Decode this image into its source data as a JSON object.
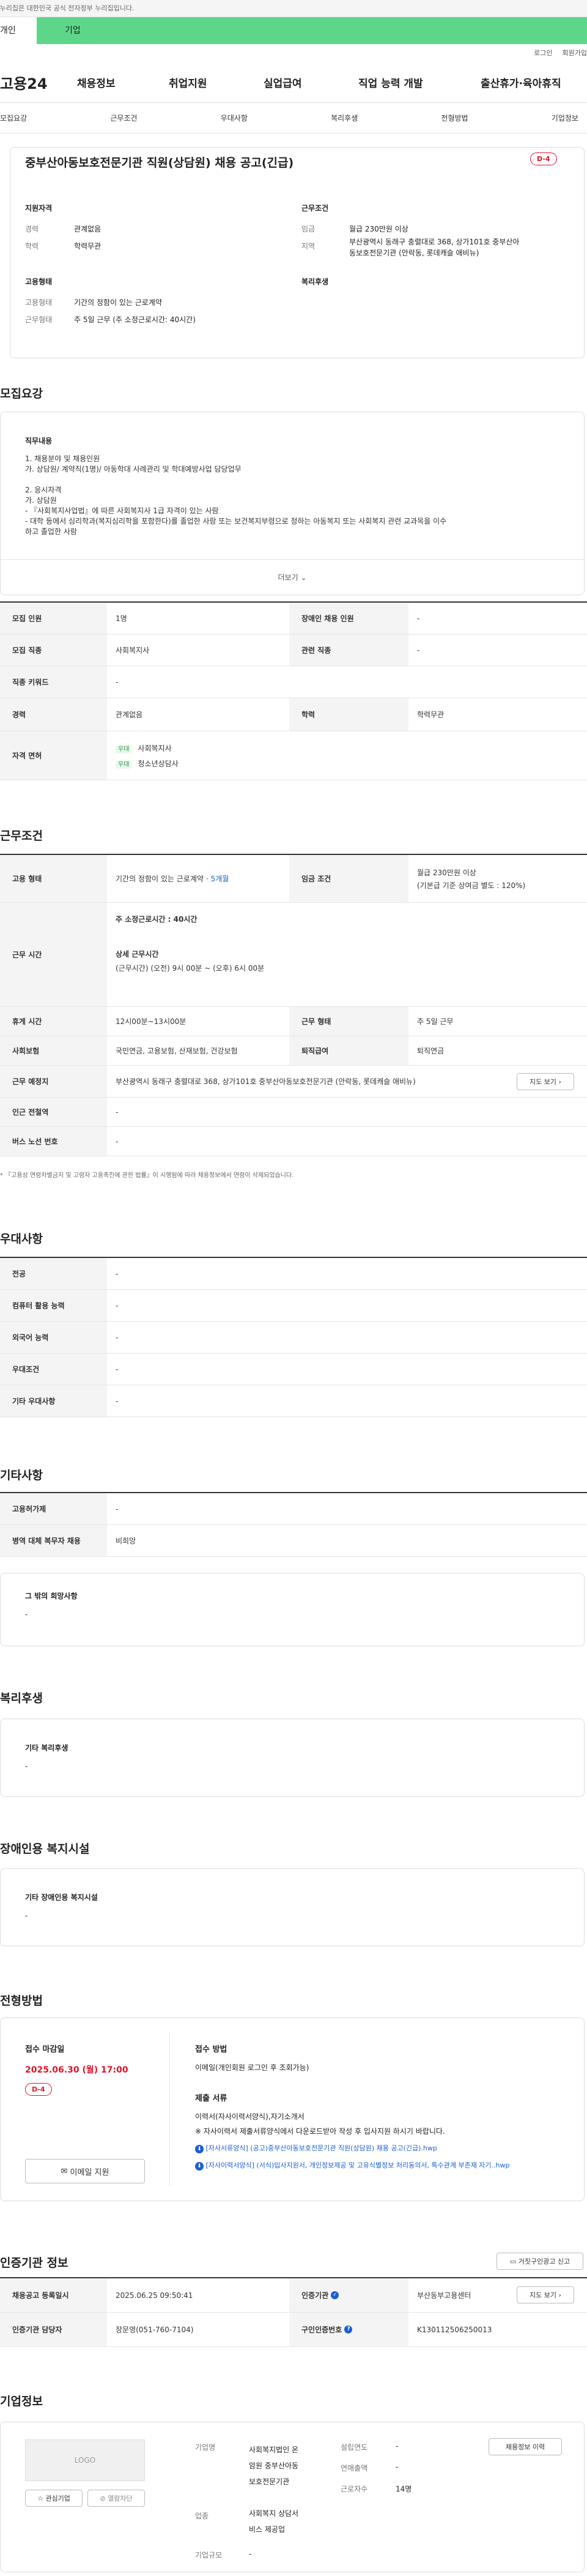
{
  "banner": {
    "notice": "이 누리집은 대한민국 공식 전자정부 누리집입니다."
  },
  "tabs": {
    "personal": "개인",
    "company": "기업"
  },
  "util": {
    "login": "로그인",
    "join": "회원가입"
  },
  "gnb": {
    "logo": "고용24",
    "menu": [
      "채용정보",
      "취업지원",
      "실업급여",
      "직업 능력 개발",
      "출산휴가·육아휴직"
    ]
  },
  "snb": [
    "모집요강",
    "근무조건",
    "우대사항",
    "복리후생",
    "전형방법",
    "기업정보"
  ],
  "job": {
    "title": "중부산아동보호전문기관 직원(상담원) 채용 공고(긴급)",
    "dday": "D-4",
    "qual_h": "지원자격",
    "cond_h": "근무조건",
    "emp_h": "고용형태",
    "welfare_h": "복리후생",
    "career_k": "경력",
    "career_v": "관계없음",
    "edu_k": "학력",
    "edu_v": "학력무관",
    "wage_k": "임금",
    "wage_v": "월급 230만원 이상",
    "area_k": "지역",
    "area_v1": "부산광역시 동래구 충렬대로 368, 상가101호 중부산아",
    "area_v2": "동보호전문기관 (안락동, 롯데캐슬 애비뉴)",
    "etype_k": "고용형태",
    "etype_v": "기간의 정함이 있는 근로계약",
    "wtype_k": "근무형태",
    "wtype_v": "주 5일 근무 (주 소정근로시간: 40시간)"
  },
  "recruit": {
    "h": "모집요강",
    "duty_h": "직무내용",
    "lines": [
      "1. 채용분야 및 채용인원",
      "가. 상담원/ 계약직(1명)/ 아동학대 사례관리 및 학대예방사업 담당업무",
      "",
      "2. 응시자격",
      "가. 상담원",
      "- 『사회복지사업법』에 따른 사회복지사 1급 자격이 있는 사람",
      "- 대학 등에서 심리학과(복지심리학을 포함한다)를 졸업한 사람 또는 보건복지부령으로 정하는 아동복지 또는 사회복지 관련 교과목을 이수",
      "하고 졸업한 사람"
    ],
    "more": "더보기"
  },
  "recruit_table": {
    "count_k": "모집 인원",
    "count_v": "1명",
    "disabled_k": "장애인 채용 인원",
    "disabled_v": "-",
    "job_k": "모집 직종",
    "job_v": "사회복지사",
    "rel_k": "관련 직종",
    "rel_v": "-",
    "kw_k": "직종 키워드",
    "kw_v": "-",
    "career_k": "경력",
    "career_v": "관계없음",
    "edu_k": "학력",
    "edu_v": "학력무관",
    "lic_k": "자격 면허",
    "lic": [
      {
        "tag": "우대",
        "name": "사회복지사"
      },
      {
        "tag": "우대",
        "name": "청소년상담사"
      }
    ]
  },
  "work": {
    "h": "근무조건",
    "etype_k": "고용 형태",
    "etype_v": "기간의 정함이 있는 근로계약 · ",
    "etype_link": "5개월",
    "wage_k": "임금 조건",
    "wage_v1": "월급 230만원 이상",
    "wage_v2": "(기본급 기준 상여금 별도 : 120%)",
    "time_k": "근무 시간",
    "time_main": "주 소정근로시간 : 40시간",
    "time_detail_h": "상세 근무시간",
    "time_detail": "(근무시간) (오전) 9시 00분 ~ (오후) 6시 00분",
    "rest_k": "휴게 시간",
    "rest_v": "12시00분~13시00분",
    "wform_k": "근무 형태",
    "wform_v": "주 5일 근무",
    "ins_k": "사회보험",
    "ins_v": "국민연금, 고용보험, 산재보험, 건강보험",
    "ret_k": "퇴직급여",
    "ret_v": "퇴직연금",
    "place_k": "근무 예정지",
    "place_v": "부산광역시 동래구 충렬대로 368, 상가101호 중부산아동보호전문기관 (안락동, 롯데캐슬 애비뉴)",
    "map_btn": "지도 보기",
    "station_k": "인근 전철역",
    "station_v": "-",
    "bus_k": "버스 노선 번호",
    "bus_v": "-",
    "note": "* 『고용상 연령차별금지 및 고령자 고용촉진에 관한 법률』이 시행됨에 따라 채용정보에서 연령이 삭제되었습니다."
  },
  "pref": {
    "h": "우대사항",
    "rows": [
      {
        "k": "전공",
        "v": "-"
      },
      {
        "k": "컴퓨터 활용 능력",
        "v": "-"
      },
      {
        "k": "외국어 능력",
        "v": "-"
      },
      {
        "k": "우대조건",
        "v": "-"
      },
      {
        "k": "기타 우대사항",
        "v": "-"
      }
    ]
  },
  "etc": {
    "h": "기타사항",
    "rows": [
      {
        "k": "고용허가제",
        "v": "-"
      },
      {
        "k": "병역 대체 복무자 채용",
        "v": "비희망"
      }
    ],
    "hope_h": "그 밖의 희망사항",
    "hope_v": "-"
  },
  "welfare": {
    "h": "복리후생",
    "box_h": "기타 복리후생",
    "box_v": "-"
  },
  "disab": {
    "h": "장애인용 복지시설",
    "box_h": "기타 장애인용 복지시설",
    "box_v": "-"
  },
  "select": {
    "h": "전형방법",
    "deadline_h": "접수 마감일",
    "deadline": "2025.06.30 (월) 17:00",
    "dday": "D-4",
    "mail_btn": "이메일 지원",
    "method_h": "접수 방법",
    "method_v": "이메일(개인회원 로그인 후 조회가능)",
    "docs_h": "제출 서류",
    "docs_v": "이력서(자사이력서양식),자기소개서",
    "docs_note": "※ 자사이력서 제출서류양식에서 다운로드받아 작성 후 입사지원 하시기 바랍니다.",
    "files": [
      "[자사서류양식] (공고)중부산아동보호전문기관 직원(상담원) 채용 공고(긴급).hwp",
      "[자사이력서양식] (서식)입사지원서, 개인정보제공 및 고유식별정보 처리동의서, 특수관계 부존재 자기..hwp"
    ]
  },
  "cert": {
    "h": "인증기관 정보",
    "report_btn": "거짓구인광고 신고",
    "reg_k": "채용공고 등록일시",
    "reg_v": "2025.06.25 09:50:41",
    "org_k": "인증기관",
    "org_v": "부산동부고용센터",
    "map_btn": "지도 보기",
    "mgr_k": "인증기관 담당자",
    "mgr_v": "장문영(051-760-7104)",
    "num_k": "구인인증번호",
    "num_v": "K130112506250013"
  },
  "company": {
    "h": "기업정보",
    "logo": "LOGO",
    "fav_btn": "관심기업",
    "block_btn": "열람차단",
    "name_k": "기업명",
    "name_v": [
      "사회복지법인 온",
      "암원 중부산아동",
      "보호전문기관"
    ],
    "ind_k": "업종",
    "ind_v": [
      "사회복지 상담서",
      "비스 제공업"
    ],
    "scale_k": "기업규모",
    "scale_v": "-",
    "year_k": "설립연도",
    "year_v": "-",
    "sales_k": "연매출액",
    "sales_v": "-",
    "emp_k": "근로자수",
    "emp_v": "14명",
    "hist_btn": "채용정보 이력"
  }
}
